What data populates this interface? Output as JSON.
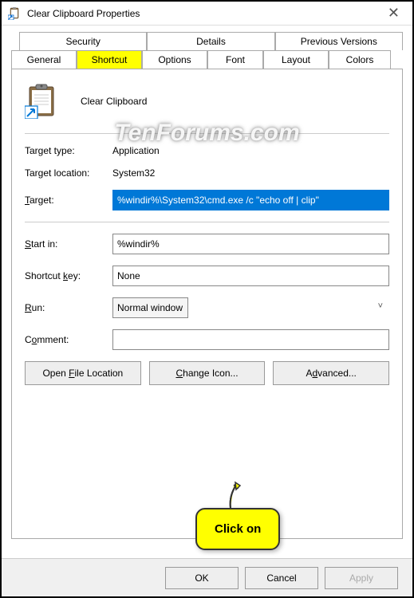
{
  "window": {
    "title": "Clear Clipboard Properties"
  },
  "tabs": {
    "upper": [
      "Security",
      "Details",
      "Previous Versions"
    ],
    "lower": [
      "General",
      "Shortcut",
      "Options",
      "Font",
      "Layout",
      "Colors"
    ],
    "active": "Shortcut"
  },
  "shortcut": {
    "name": "Clear Clipboard",
    "target_type_label": "Target type:",
    "target_type": "Application",
    "target_location_label": "Target location:",
    "target_location": "System32",
    "target_label": "Target:",
    "target": "%windir%\\System32\\cmd.exe /c \"echo off | clip\"",
    "start_in_label": "Start in:",
    "start_in": "%windir%",
    "shortcut_key_label": "Shortcut key:",
    "shortcut_key": "None",
    "run_label": "Run:",
    "run": "Normal window",
    "comment_label": "Comment:",
    "comment": ""
  },
  "buttons": {
    "open_location": "Open File Location",
    "change_icon": "Change Icon...",
    "advanced": "Advanced..."
  },
  "footer": {
    "ok": "OK",
    "cancel": "Cancel",
    "apply": "Apply"
  },
  "watermark": "TenForums.com",
  "callout": "Click on"
}
